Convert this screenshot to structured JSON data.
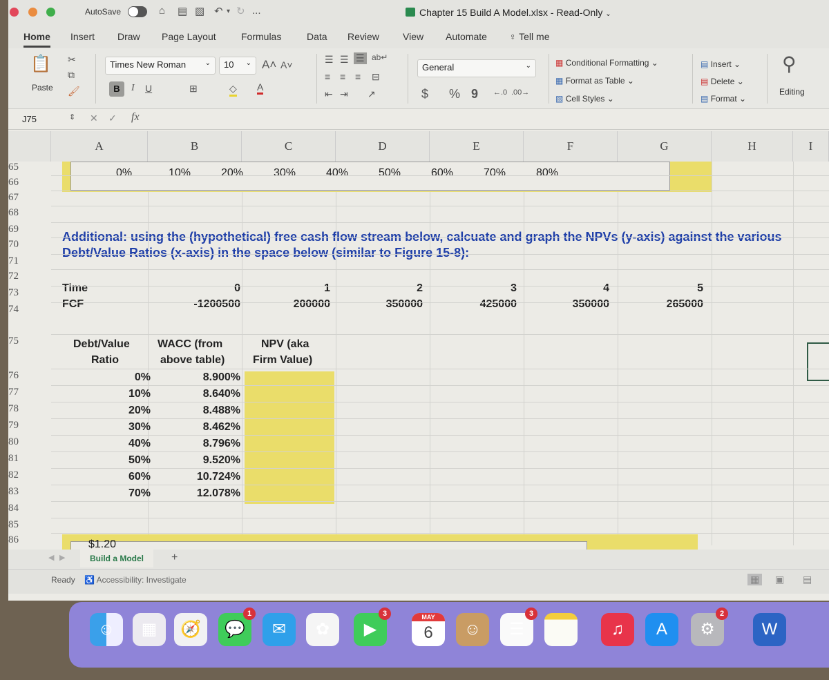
{
  "window": {
    "autosave_label": "AutoSave",
    "autosave_on": false,
    "document_title": "Chapter 15 Build A Model.xlsx",
    "document_state": "Read-Only",
    "more_label": "..."
  },
  "ribbon_tabs": [
    "Home",
    "Insert",
    "Draw",
    "Page Layout",
    "Formulas",
    "Data",
    "Review",
    "View",
    "Automate",
    "Tell me"
  ],
  "active_tab": "Home",
  "ribbon": {
    "paste_label": "Paste",
    "font_name": "Times New Roman",
    "font_size": "10",
    "bold": "B",
    "italic": "I",
    "underline": "U",
    "number_format": "General",
    "currency": "$",
    "percent": "%",
    "comma": "9",
    "conditional_formatting": "Conditional Formatting",
    "format_as_table": "Format as Table",
    "cell_styles": "Cell Styles",
    "insert": "Insert",
    "delete": "Delete",
    "format": "Format",
    "editing": "Editing"
  },
  "formula_bar": {
    "name_box": "J75",
    "fx": "fx",
    "value": ""
  },
  "columns": [
    "A",
    "B",
    "C",
    "D",
    "E",
    "F",
    "G",
    "H",
    "I"
  ],
  "rows": [
    "65",
    "66",
    "67",
    "68",
    "69",
    "70",
    "71",
    "72",
    "73",
    "74",
    "75",
    "76",
    "77",
    "78",
    "79",
    "80",
    "81",
    "82",
    "83",
    "84",
    "85",
    "86"
  ],
  "chart_axis_labels": [
    "0%",
    "10%",
    "20%",
    "30%",
    "40%",
    "50%",
    "60%",
    "70%",
    "80%"
  ],
  "instruction": {
    "line1": "Additional: using the (hypothetical) free cash flow stream below, calcuate and graph the NPVs (y-axis) against the various",
    "line2": "Debt/Value Ratios (x-axis) in the space below (similar to Figure 15-8):"
  },
  "cashflow": {
    "time_label": "Time",
    "fcf_label": "FCF",
    "times": [
      "0",
      "1",
      "2",
      "3",
      "4",
      "5"
    ],
    "fcf": [
      "-1200500",
      "200000",
      "350000",
      "425000",
      "350000",
      "265000"
    ]
  },
  "wacc_table": {
    "headers": {
      "dv_line1": "Debt/Value",
      "dv_line2": "Ratio",
      "wacc_line1": "WACC (from",
      "wacc_line2": "above table)",
      "npv_line1": "NPV (aka",
      "npv_line2": "Firm Value)"
    },
    "rows": [
      {
        "dv": "0%",
        "wacc": "8.900%",
        "npv": ""
      },
      {
        "dv": "10%",
        "wacc": "8.640%",
        "npv": ""
      },
      {
        "dv": "20%",
        "wacc": "8.488%",
        "npv": ""
      },
      {
        "dv": "30%",
        "wacc": "8.462%",
        "npv": ""
      },
      {
        "dv": "40%",
        "wacc": "8.796%",
        "npv": ""
      },
      {
        "dv": "50%",
        "wacc": "9.520%",
        "npv": ""
      },
      {
        "dv": "60%",
        "wacc": "10.724%",
        "npv": ""
      },
      {
        "dv": "70%",
        "wacc": "12.078%",
        "npv": ""
      }
    ]
  },
  "lower_chart_axis_label": "$1.20",
  "sheet_tabs": [
    "Build a Model"
  ],
  "add_sheet": "+",
  "status": {
    "ready": "Ready",
    "accessibility": "Accessibility: Investigate"
  },
  "dock": {
    "apps": [
      {
        "name": "Finder",
        "badge": ""
      },
      {
        "name": "Launchpad",
        "badge": ""
      },
      {
        "name": "Safari",
        "badge": ""
      },
      {
        "name": "Messages",
        "badge": "1"
      },
      {
        "name": "Mail",
        "badge": ""
      },
      {
        "name": "Photos",
        "badge": ""
      },
      {
        "name": "FaceTime",
        "badge": "3"
      },
      {
        "name": "Calendar",
        "badge": "",
        "month": "MAY",
        "day": "6"
      },
      {
        "name": "Contacts",
        "badge": ""
      },
      {
        "name": "Reminders",
        "badge": "3"
      },
      {
        "name": "Notes",
        "badge": ""
      },
      {
        "name": "Music",
        "badge": ""
      },
      {
        "name": "App Store",
        "badge": ""
      },
      {
        "name": "System Settings",
        "badge": "2"
      },
      {
        "name": "Word",
        "badge": ""
      }
    ]
  },
  "colors": {
    "highlight_yellow": "#eadd6a",
    "instruction_blue": "#1f3fa8",
    "dock_purple": "#8f84d8"
  }
}
